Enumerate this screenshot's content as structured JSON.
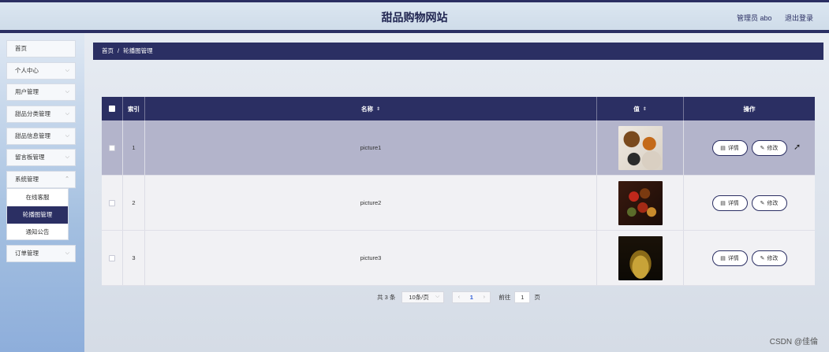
{
  "header": {
    "site_title": "甜品购物网站",
    "admin_label": "管理员 abo",
    "logout_label": "退出登录"
  },
  "sidebar": {
    "items": [
      {
        "label": "首页",
        "has_arrow": false
      },
      {
        "label": "个人中心",
        "has_arrow": true
      },
      {
        "label": "用户管理",
        "has_arrow": true
      },
      {
        "label": "甜品分类管理",
        "has_arrow": true
      },
      {
        "label": "甜品信息管理",
        "has_arrow": true
      },
      {
        "label": "留言板管理",
        "has_arrow": true
      },
      {
        "label": "系统管理",
        "has_arrow": true
      },
      {
        "label": "订单管理",
        "has_arrow": true
      }
    ],
    "submenu": [
      {
        "label": "在线客服",
        "active": false
      },
      {
        "label": "轮播图管理",
        "active": true
      },
      {
        "label": "通知公告",
        "active": false
      }
    ]
  },
  "breadcrumb": {
    "home": "首页",
    "separator": "/",
    "current": "轮播图管理"
  },
  "table": {
    "columns": {
      "index": "索引",
      "name": "名称",
      "value": "值",
      "actions": "操作"
    },
    "rows": [
      {
        "index": "1",
        "name": "picture1",
        "image": "dessert-plate-photo"
      },
      {
        "index": "2",
        "name": "picture2",
        "image": "fruit-cake-photo"
      },
      {
        "index": "3",
        "name": "picture3",
        "image": "honey-spoon-photo"
      }
    ],
    "detail_label": "详情",
    "edit_label": "修改"
  },
  "pagination": {
    "total": "共 3 条",
    "page_size": "10条/页",
    "current_page": "1",
    "goto_label": "前往",
    "goto_value": "1",
    "page_unit": "页"
  },
  "watermark": "CSDN @佳倫",
  "colors": {
    "primary": "#2b2f63",
    "row_hover": "#b3b4cb",
    "row_bg": "#f1f1f4"
  }
}
